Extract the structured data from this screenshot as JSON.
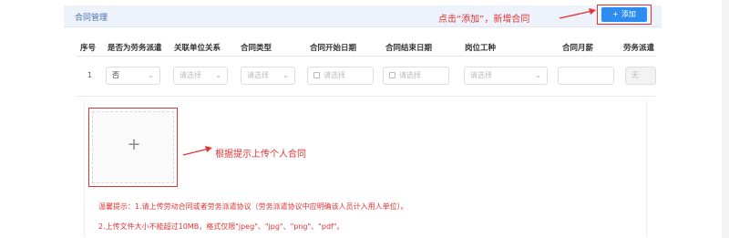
{
  "header": {
    "title": "合同管理",
    "annotation": "点击“添加”，新增合同",
    "add_icon": "plus-icon",
    "add_label": "添加"
  },
  "table": {
    "columns": [
      "序号",
      "是否为劳务派遣",
      "关联单位关系",
      "合同类型",
      "合同开始日期",
      "合同结束日期",
      "岗位工种",
      "合同月薪",
      "劳务派遣"
    ],
    "row": {
      "index": "1",
      "is_dispatch": "否",
      "unit_relation_placeholder": "请选择",
      "contract_type_placeholder": "请选择",
      "start_date_placeholder": "请选择",
      "end_date_placeholder": "请选择",
      "position_placeholder": "请选择",
      "salary_value": "",
      "dispatch_value": "无"
    }
  },
  "upload": {
    "plus_icon": "plus-icon",
    "annotation": "根据提示上传个人合同"
  },
  "tips": {
    "line1": "温馨提示：1.请上传劳动合同或者劳务派遣协议（劳务派遣协议中应明确该人员计入用人单位）。",
    "line2": "2.上传文件大小不能超过10MB，格式仅限\"jpeg\"、\"jpg\"、\"png\"、\"pdf\"。"
  },
  "colors": {
    "accent": "#2d8cf0",
    "annotation_red": "#e23434",
    "header_bg": "#eef3fb"
  }
}
